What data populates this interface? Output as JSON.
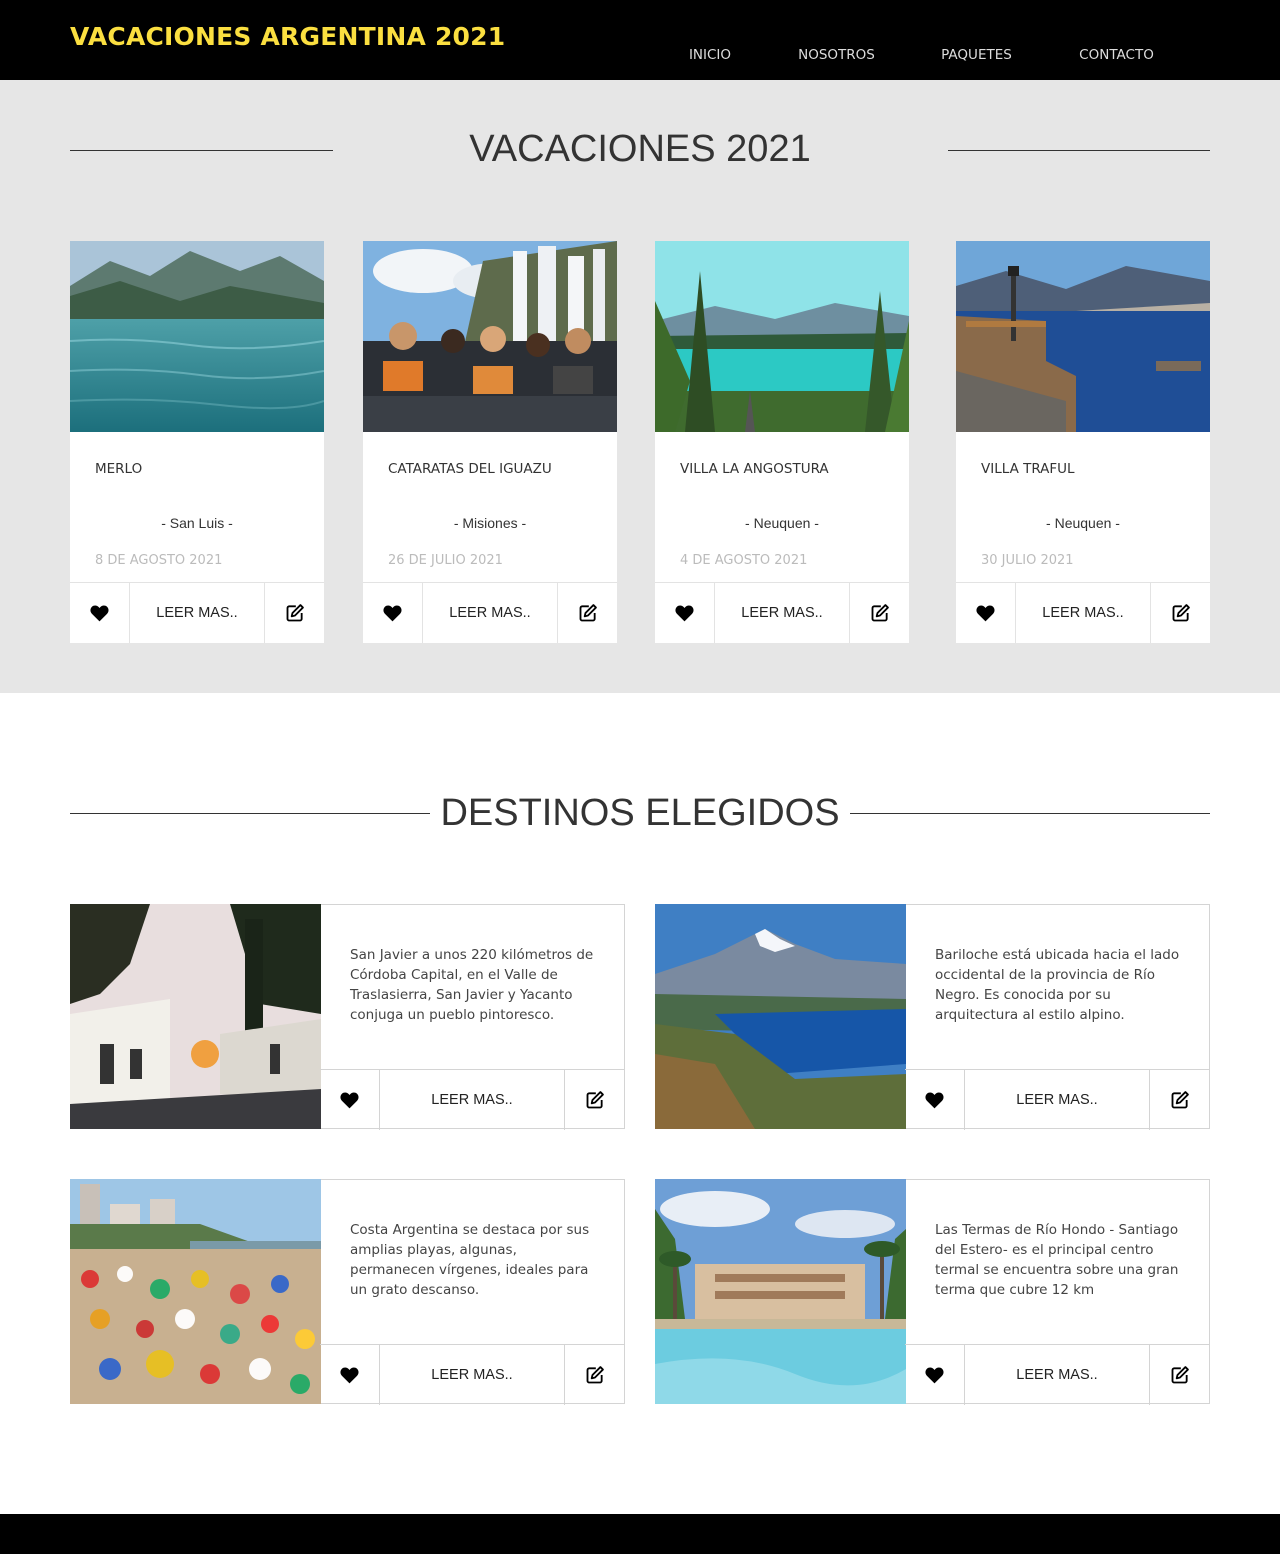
{
  "header": {
    "brand": "VACACIONES ARGENTINA 2021",
    "nav": [
      {
        "label": "INICIO",
        "active": true
      },
      {
        "label": "NOSOTROS",
        "active": false
      },
      {
        "label": "PAQUETES",
        "active": false
      },
      {
        "label": "CONTACTO",
        "active": true
      }
    ]
  },
  "colors": {
    "accent": "#fddf45",
    "header_bg": "#000000",
    "section_bg": "#e6e6e6"
  },
  "vacaciones": {
    "title": "VACACIONES 2021",
    "cards": [
      {
        "name": "MERLO",
        "province": "- San Luis -",
        "date": "8 DE AGOSTO 2021",
        "read_more": "LEER MAS..",
        "image": "mountain-lake-photo"
      },
      {
        "name": "CATARATAS DEL IGUAZU",
        "province": "- Misiones -",
        "date": "26 DE JULIO 2021",
        "read_more": "LEER MAS..",
        "image": "waterfall-boat-photo"
      },
      {
        "name": "VILLA LA ANGOSTURA",
        "province": "- Neuquen -",
        "date": "4 DE AGOSTO 2021",
        "read_more": "LEER MAS..",
        "image": "turquoise-lake-forest-photo"
      },
      {
        "name": "VILLA TRAFUL",
        "province": "- Neuquen -",
        "date": "30 JULIO 2021",
        "read_more": "LEER MAS..",
        "image": "wooden-pier-lake-photo"
      }
    ]
  },
  "destinos": {
    "title": "DESTINOS ELEGIDOS",
    "items": [
      {
        "text": "San Javier a unos 220 kilómetros de Córdoba Capital, en el Valle de Traslasierra, San Javier y Yacanto conjuga un pueblo pintoresco.",
        "read_more": "LEER MAS..",
        "image": "village-street-sunset-photo"
      },
      {
        "text": "Bariloche está ubicada hacia el lado occidental de la provincia de Río Negro. Es conocida por su arquitectura al estilo alpino.",
        "read_more": "LEER MAS..",
        "image": "snowy-mountain-lake-photo"
      },
      {
        "text": "Costa Argentina se destaca por sus amplias playas, algunas, permanecen vírgenes, ideales para un grato descanso.",
        "read_more": "LEER MAS..",
        "image": "crowded-beach-photo"
      },
      {
        "text": "Las Termas de Río Hondo - Santiago del Estero- es el principal centro termal se encuentra sobre una gran terma que cubre 12 km",
        "read_more": "LEER MAS..",
        "image": "thermal-pool-hotel-photo"
      }
    ]
  }
}
